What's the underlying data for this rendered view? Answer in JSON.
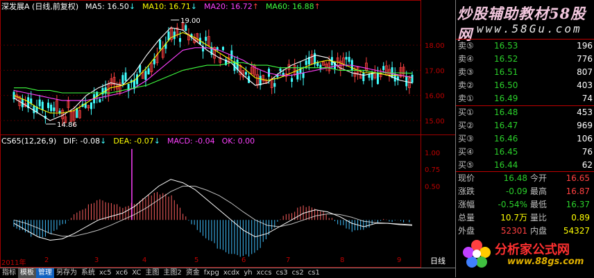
{
  "main_header": {
    "stock": "深发展A",
    "mode": "(日线,前复权)",
    "ma5": "MA5: 16.50",
    "ma10": "MA10: 16.71",
    "ma20": "MA20: 16.72",
    "ma60": "MA60: 16.88",
    "arrow_down": "↓",
    "arrow_up": "↑"
  },
  "macd_header": {
    "name": "CS65(12,26,9)",
    "dif": "DIF: -0.08",
    "dea": "DEA: -0.07",
    "macd": "MACD: -0.04",
    "ok": "OK: 0.00",
    "arrow_down": "↓"
  },
  "annotations": {
    "high": "19.00",
    "low": "14.86"
  },
  "y_axis_price": [
    "18.00",
    "17.00",
    "16.00",
    "15.00"
  ],
  "y_axis_macd": [
    "1.00",
    "0.75",
    "0.50"
  ],
  "x_axis": [
    "2011年",
    "2",
    "3",
    "4",
    "5",
    "6",
    "7",
    "8",
    "9"
  ],
  "period": "日线",
  "banner_top": {
    "line1": "炒股辅助教材58股网",
    "line2": "www.58Gu.com"
  },
  "order_book": {
    "sells": [
      {
        "label": "卖⑤",
        "price": "16.53",
        "vol": "196"
      },
      {
        "label": "卖④",
        "price": "16.52",
        "vol": "776"
      },
      {
        "label": "卖③",
        "price": "16.51",
        "vol": "807"
      },
      {
        "label": "卖②",
        "price": "16.50",
        "vol": "403"
      },
      {
        "label": "卖①",
        "price": "16.49",
        "vol": "74"
      }
    ],
    "buys": [
      {
        "label": "买①",
        "price": "16.48",
        "vol": "453"
      },
      {
        "label": "买②",
        "price": "16.47",
        "vol": "969"
      },
      {
        "label": "买③",
        "price": "16.46",
        "vol": "106"
      },
      {
        "label": "买④",
        "price": "16.45",
        "vol": "76"
      },
      {
        "label": "买⑤",
        "price": "16.44",
        "vol": "62"
      }
    ]
  },
  "stats": {
    "rows": [
      {
        "l1": "现价",
        "v1": "16.48",
        "c1": "#2bd12b",
        "l2": "今开",
        "v2": "16.65",
        "c2": "#ff4040"
      },
      {
        "l1": "涨跌",
        "v1": "-0.09",
        "c1": "#2bd12b",
        "l2": "最高",
        "v2": "16.87",
        "c2": "#ff4040"
      },
      {
        "l1": "涨幅",
        "v1": "-0.54%",
        "c1": "#2bd12b",
        "l2": "最低",
        "v2": "16.37",
        "c2": "#2bd12b"
      },
      {
        "l1": "总量",
        "v1": "10.7万",
        "c1": "#ffff00",
        "l2": "量比",
        "v2": "0.89",
        "c2": "#ffff00"
      },
      {
        "l1": "外盘",
        "v1": "52301",
        "c1": "#ff4040",
        "l2": "内盘",
        "v2": "54327",
        "c2": "#ffff00"
      }
    ]
  },
  "banner_bottom": {
    "line1": "分析家公式网",
    "line2": "www.88gs.com"
  },
  "tabs": [
    "指标",
    "模板",
    "管理",
    "另存为",
    "系统",
    "xc5",
    "xc6",
    "XC",
    "主图",
    "主图2",
    "资金",
    "fxpg",
    "xcdx",
    "yh",
    "xccs",
    "cs3",
    "cs2",
    "cs1"
  ],
  "colors": {
    "up": "#ff4040",
    "down": "#2bd12b",
    "ma5": "#ffffff",
    "ma10": "#ffff00",
    "ma20": "#ff40ff",
    "ma60": "#40ff40",
    "macd_pos": "#ff6060",
    "macd_neg": "#40c0ff"
  },
  "chart_data": {
    "type": "line",
    "title": "深发展A (日线,前复权)",
    "series": [
      {
        "name": "MA5",
        "values": [
          15.9,
          15.6,
          15.3,
          15.0,
          15.2,
          15.5,
          16.0,
          16.3,
          16.5,
          16.4,
          16.9,
          17.6,
          18.2,
          18.7,
          18.6,
          18.2,
          17.8,
          17.5,
          17.3,
          16.8,
          16.4,
          16.5,
          16.9,
          17.2,
          17.4,
          17.6,
          17.5,
          17.1,
          16.9,
          16.8,
          16.9,
          16.8,
          16.6,
          16.5
        ]
      },
      {
        "name": "MA10",
        "values": [
          16.0,
          15.8,
          15.5,
          15.3,
          15.3,
          15.4,
          15.7,
          16.0,
          16.3,
          16.4,
          16.6,
          17.1,
          17.7,
          18.3,
          18.5,
          18.3,
          18.0,
          17.7,
          17.4,
          17.1,
          16.7,
          16.6,
          16.7,
          16.9,
          17.1,
          17.3,
          17.4,
          17.3,
          17.1,
          16.9,
          16.9,
          16.8,
          16.8,
          16.71
        ]
      },
      {
        "name": "MA20",
        "values": [
          16.2,
          16.1,
          16.0,
          15.9,
          15.8,
          15.8,
          15.8,
          15.9,
          16.0,
          16.1,
          16.3,
          16.6,
          17.0,
          17.4,
          17.8,
          17.9,
          17.9,
          17.8,
          17.6,
          17.4,
          17.1,
          16.9,
          16.8,
          16.8,
          16.9,
          17.0,
          17.1,
          17.2,
          17.2,
          17.1,
          17.0,
          16.9,
          16.8,
          16.72
        ]
      },
      {
        "name": "MA60",
        "values": [
          16.3,
          16.3,
          16.2,
          16.2,
          16.1,
          16.1,
          16.1,
          16.1,
          16.1,
          16.2,
          16.3,
          16.4,
          16.6,
          16.8,
          17.0,
          17.1,
          17.2,
          17.2,
          17.3,
          17.3,
          17.2,
          17.2,
          17.1,
          17.1,
          17.1,
          17.1,
          17.1,
          17.0,
          17.0,
          17.0,
          16.9,
          16.9,
          16.9,
          16.88
        ]
      }
    ],
    "ylim": [
      14.5,
      19.3
    ],
    "macd": {
      "dif": [
        -0.05,
        -0.15,
        -0.25,
        -0.3,
        -0.28,
        -0.2,
        -0.1,
        0.0,
        0.05,
        0.1,
        0.2,
        0.35,
        0.5,
        0.6,
        0.55,
        0.45,
        0.3,
        0.15,
        0.0,
        -0.15,
        -0.25,
        -0.2,
        -0.1,
        0.0,
        0.1,
        0.15,
        0.12,
        0.05,
        -0.05,
        -0.1,
        -0.05,
        -0.05,
        -0.07,
        -0.08
      ],
      "dea": [
        0.0,
        -0.05,
        -0.12,
        -0.2,
        -0.24,
        -0.24,
        -0.2,
        -0.15,
        -0.08,
        0.0,
        0.08,
        0.18,
        0.3,
        0.42,
        0.5,
        0.5,
        0.44,
        0.36,
        0.25,
        0.12,
        0.0,
        -0.08,
        -0.1,
        -0.06,
        0.0,
        0.06,
        0.09,
        0.08,
        0.04,
        -0.02,
        -0.04,
        -0.05,
        -0.06,
        -0.07
      ],
      "ylim": [
        -0.5,
        1.1
      ]
    }
  }
}
